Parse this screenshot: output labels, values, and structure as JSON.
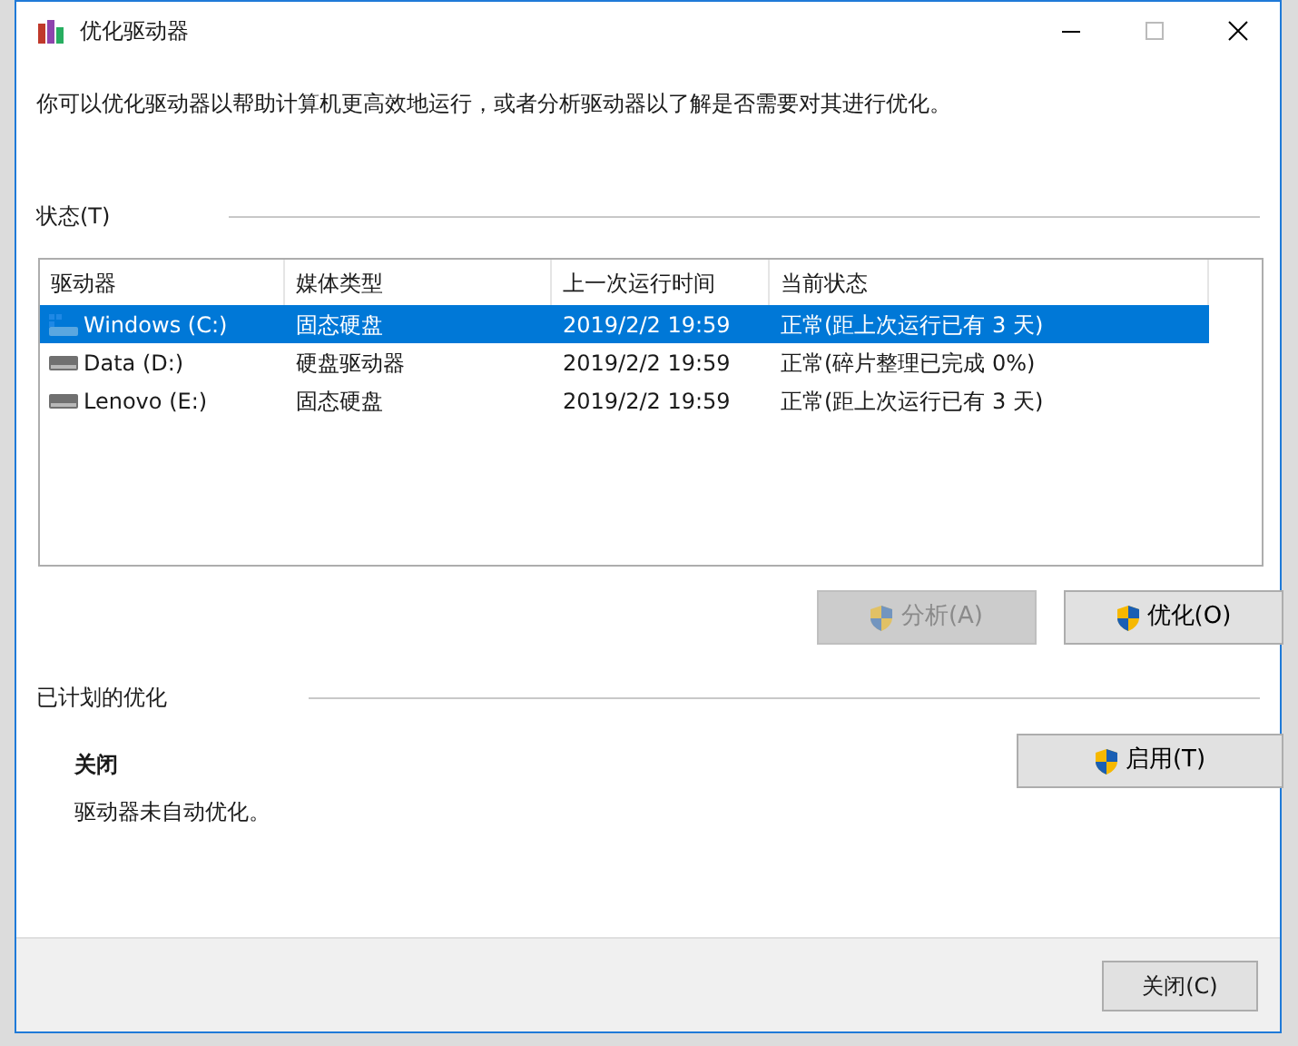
{
  "window": {
    "title": "优化驱动器"
  },
  "description": "你可以优化驱动器以帮助计算机更高效地运行，或者分析驱动器以了解是否需要对其进行优化。",
  "status": {
    "label": "状态(T)",
    "columns": [
      "驱动器",
      "媒体类型",
      "上一次运行时间",
      "当前状态"
    ],
    "drives": [
      {
        "name": "Windows (C:)",
        "kind": "system",
        "media": "固态硬盘",
        "last_run": "2019/2/2 19:59",
        "state": "正常(距上次运行已有 3 天)",
        "selected": true
      },
      {
        "name": "Data (D:)",
        "kind": "disk",
        "media": "硬盘驱动器",
        "last_run": "2019/2/2 19:59",
        "state": "正常(碎片整理已完成 0%)",
        "selected": false
      },
      {
        "name": "Lenovo (E:)",
        "kind": "disk",
        "media": "固态硬盘",
        "last_run": "2019/2/2 19:59",
        "state": "正常(距上次运行已有 3 天)",
        "selected": false
      }
    ],
    "buttons": [
      {
        "label": "分析(A)",
        "disabled": true
      },
      {
        "label": "优化(O)",
        "disabled": false
      }
    ]
  },
  "schedule": {
    "label": "已计划的优化",
    "state": "关闭",
    "note": "驱动器未自动优化。",
    "button": {
      "label": "启用(T)",
      "disabled": false
    }
  },
  "footer": {
    "close_button": "关闭(C)"
  }
}
